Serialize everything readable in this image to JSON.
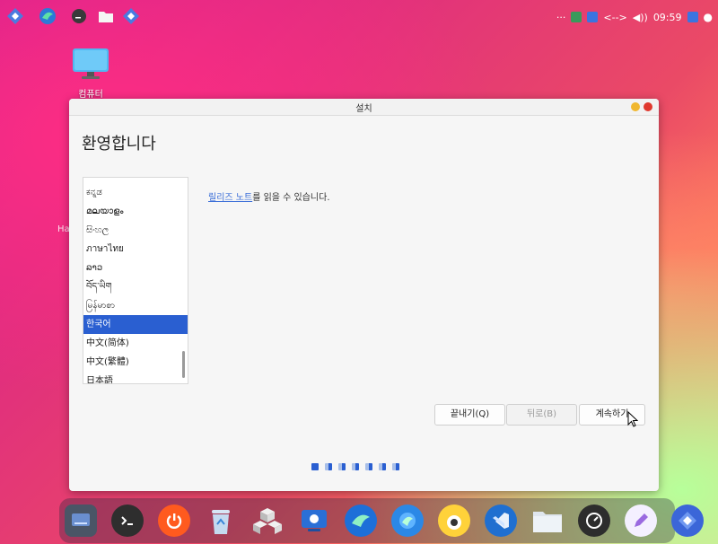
{
  "desktop": {
    "computer_label": "컴퓨터",
    "side_text": "Ha"
  },
  "topbar": {
    "dots": "···",
    "time": "09:59",
    "network": "<-->",
    "volume": "◀))"
  },
  "window": {
    "title": "설치",
    "heading": "환영합니다",
    "release_link": "릴리즈 노트",
    "release_text": "를 읽을 수 있습니다.",
    "languages": [
      {
        "label": "ಕನ್ನಡ",
        "selected": false
      },
      {
        "label": "മലയാളം",
        "selected": false
      },
      {
        "label": "සිංහල",
        "selected": false
      },
      {
        "label": "ภาษาไทย",
        "selected": false
      },
      {
        "label": "ລາວ",
        "selected": false
      },
      {
        "label": "བོད་ཡིག",
        "selected": false
      },
      {
        "label": "မြန်မာစာ",
        "selected": false
      },
      {
        "label": "한국어",
        "selected": true
      },
      {
        "label": "中文(简体)",
        "selected": false
      },
      {
        "label": "中文(繁體)",
        "selected": false
      },
      {
        "label": "日本語",
        "selected": false
      }
    ],
    "buttons": {
      "quit": "끝내기(Q)",
      "back": "뒤로(B)",
      "continue": "계속하기"
    },
    "progress": {
      "total_steps": 7,
      "current_step": 1
    }
  },
  "colors": {
    "accent": "#2a5fd1",
    "close_button": "#e0392f",
    "minimize_button": "#f0b72f"
  },
  "dock": {
    "items": [
      "display-icon",
      "terminal-icon",
      "power-icon",
      "trash-icon",
      "cubes-icon",
      "screen-recorder-icon",
      "bird-icon",
      "vscode-icon",
      "folder-icon",
      "monitor-icon",
      "pen-icon",
      "installer-icon"
    ]
  }
}
